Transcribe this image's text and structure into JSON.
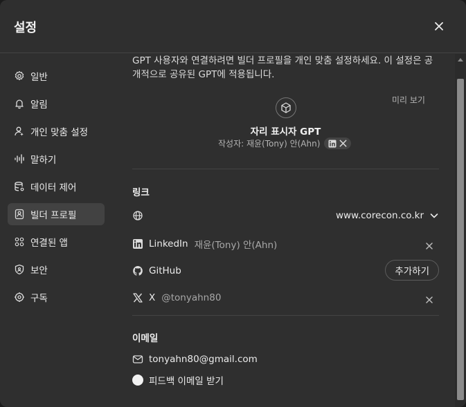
{
  "dialog": {
    "title": "설정"
  },
  "sidebar": {
    "items": [
      {
        "label": "일반",
        "icon": "gear-icon"
      },
      {
        "label": "알림",
        "icon": "bell-icon"
      },
      {
        "label": "개인 맞춤 설정",
        "icon": "person-icon"
      },
      {
        "label": "말하기",
        "icon": "waveform-icon"
      },
      {
        "label": "데이터 제어",
        "icon": "database-icon"
      },
      {
        "label": "빌더 프로필",
        "icon": "id-card-icon",
        "active": true
      },
      {
        "label": "연결된 앱",
        "icon": "apps-grid-icon"
      },
      {
        "label": "보안",
        "icon": "shield-icon"
      },
      {
        "label": "구독",
        "icon": "subscription-icon"
      }
    ]
  },
  "builder_profile": {
    "description": "GPT 사용자와 연결하려면 빌더 프로필을 개인 맞춤 설정하세요. 이 설정은 공개적으로 공유된 GPT에 적용됩니다.",
    "preview_label": "미리 보기",
    "gpt_name": "자리 표시자 GPT",
    "author": "작성자: 재윤(Tony) 안(Ahn)",
    "links": {
      "title": "링크",
      "domain": "www.corecon.co.kr",
      "linkedin_label": "LinkedIn",
      "linkedin_value": "재윤(Tony) 안(Ahn)",
      "github_label": "GitHub",
      "github_add": "추가하기",
      "x_label": "X",
      "x_value": "@tonyahn80"
    },
    "email": {
      "title": "이메일",
      "address": "tonyahn80@gmail.com",
      "feedback_label": "피드백 이메일 받기"
    }
  }
}
